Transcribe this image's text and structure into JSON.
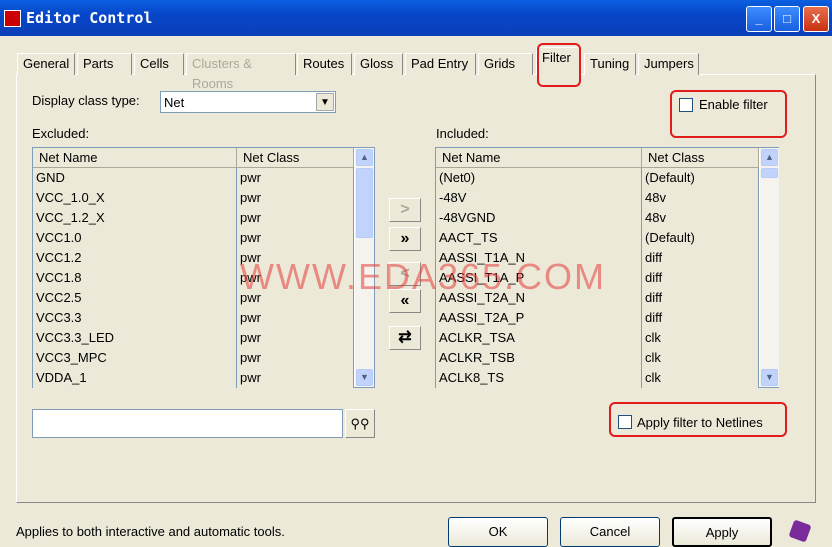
{
  "window": {
    "title": "Editor Control",
    "minimize": "_",
    "maximize": "□",
    "close": "X"
  },
  "tabs": [
    {
      "label": "General"
    },
    {
      "label": "Parts"
    },
    {
      "label": "Cells"
    },
    {
      "label": "Clusters & Rooms",
      "disabled": true
    },
    {
      "label": "Routes"
    },
    {
      "label": "Gloss"
    },
    {
      "label": "Pad Entry"
    },
    {
      "label": "Grids"
    },
    {
      "label": "Filter",
      "active": true
    },
    {
      "label": "Tuning"
    },
    {
      "label": "Jumpers"
    }
  ],
  "filter": {
    "display_class_label": "Display class type:",
    "display_class_value": "Net",
    "enable_filter_label": "Enable filter",
    "enable_filter_checked": false,
    "excluded_label": "Excluded:",
    "included_label": "Included:",
    "columns": [
      "Net Name",
      "Net Class"
    ],
    "excluded": [
      [
        "GND",
        "pwr"
      ],
      [
        "VCC_1.0_X",
        "pwr"
      ],
      [
        "VCC_1.2_X",
        "pwr"
      ],
      [
        "VCC1.0",
        "pwr"
      ],
      [
        "VCC1.2",
        "pwr"
      ],
      [
        "VCC1.8",
        "pwr"
      ],
      [
        "VCC2.5",
        "pwr"
      ],
      [
        "VCC3.3",
        "pwr"
      ],
      [
        "VCC3.3_LED",
        "pwr"
      ],
      [
        "VCC3_MPC",
        "pwr"
      ],
      [
        "VDDA_1",
        "pwr"
      ]
    ],
    "included": [
      [
        "(Net0)",
        "(Default)"
      ],
      [
        "-48V",
        "48v"
      ],
      [
        "-48VGND",
        "48v"
      ],
      [
        "AACT_TS",
        "(Default)"
      ],
      [
        "AASSI_T1A_N",
        "diff"
      ],
      [
        "AASSI_T1A_P",
        "diff"
      ],
      [
        "AASSI_T2A_N",
        "diff"
      ],
      [
        "AASSI_T2A_P",
        "diff"
      ],
      [
        "ACLKR_TSA",
        "clk"
      ],
      [
        "ACLKR_TSB",
        "clk"
      ],
      [
        "ACLK8_TS",
        "clk"
      ]
    ],
    "move_buttons": [
      ">",
      "»",
      "<",
      "«",
      "⇄"
    ],
    "search_value": "",
    "apply_netlines_label": "Apply filter to Netlines",
    "apply_netlines_checked": false
  },
  "status_text": "Applies to both interactive and automatic tools.",
  "buttons": {
    "ok": "OK",
    "cancel": "Cancel",
    "apply": "Apply"
  },
  "watermark": "WWW.EDA365.COM"
}
